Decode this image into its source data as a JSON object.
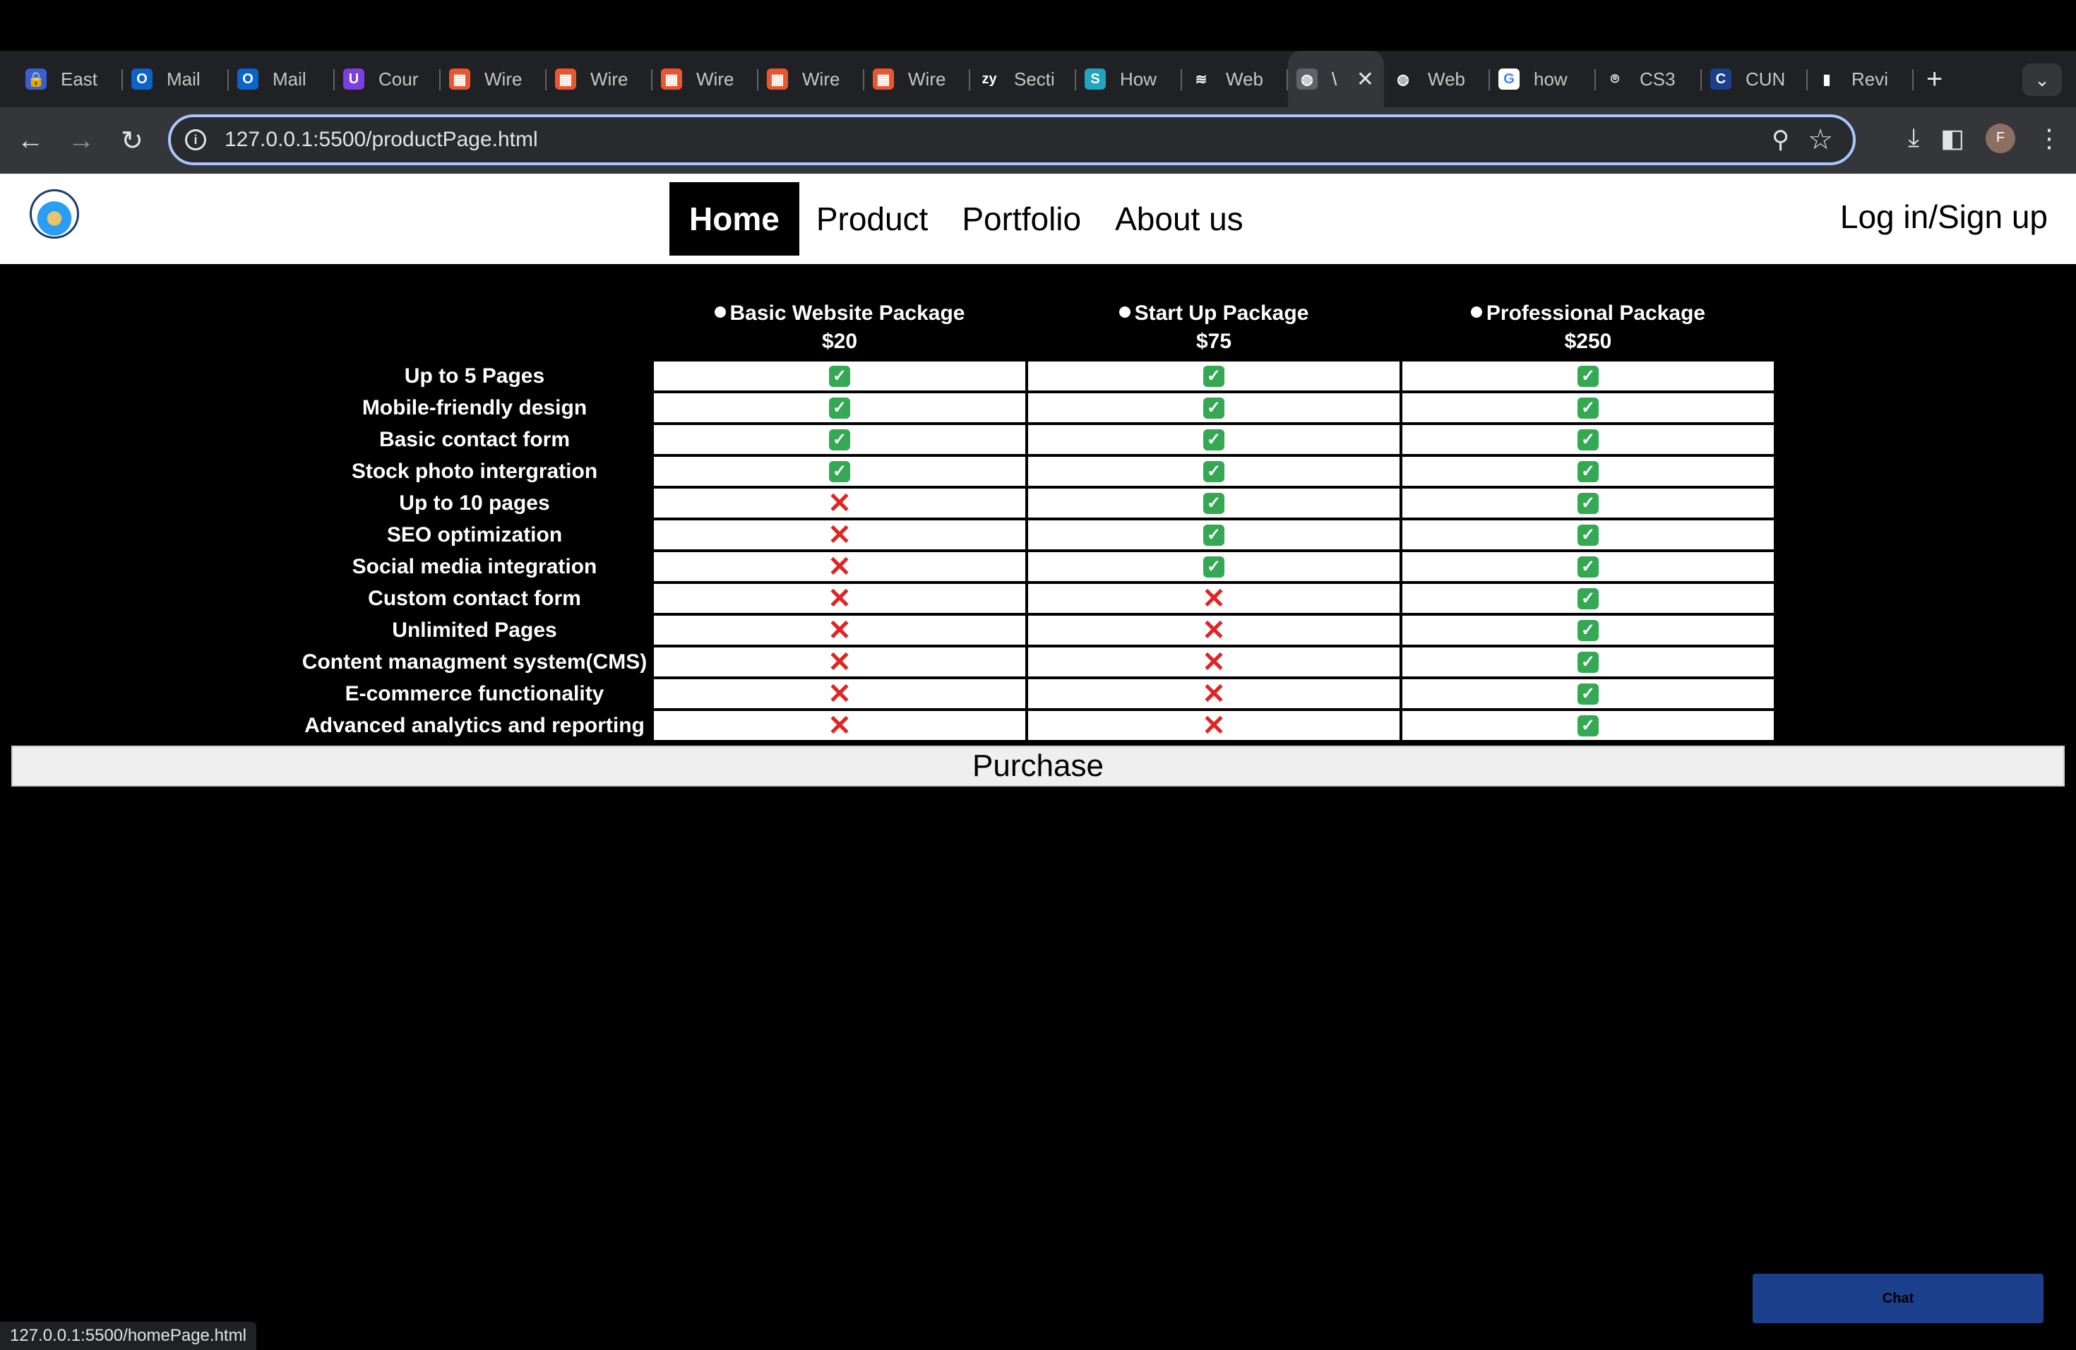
{
  "browser": {
    "tabs": [
      {
        "title": "East",
        "color": "#3b5fd1",
        "glyph": "🔒"
      },
      {
        "title": "Mail",
        "color": "#0a64c9",
        "glyph": "O"
      },
      {
        "title": "Mail",
        "color": "#0a64c9",
        "glyph": "O"
      },
      {
        "title": "Cour",
        "color": "#7b3fe4",
        "glyph": "U"
      },
      {
        "title": "Wire",
        "color": "#e8572f",
        "glyph": "▦"
      },
      {
        "title": "Wire",
        "color": "#e8572f",
        "glyph": "▦"
      },
      {
        "title": "Wire",
        "color": "#e8572f",
        "glyph": "▦"
      },
      {
        "title": "Wire",
        "color": "#e8572f",
        "glyph": "▦"
      },
      {
        "title": "Wire",
        "color": "#e8572f",
        "glyph": "▦"
      },
      {
        "title": "Secti",
        "color": "#202124",
        "glyph": "zy"
      },
      {
        "title": "How",
        "color": "#21a3c1",
        "glyph": "S"
      },
      {
        "title": "Web",
        "color": "#202124",
        "glyph": "≋"
      }
    ],
    "active_tab": {
      "title": "\\",
      "glyph": "◍"
    },
    "tabs_after": [
      {
        "title": "Web",
        "color": "#202124",
        "glyph": "◍"
      },
      {
        "title": "how",
        "color": "#ffffff",
        "glyph": "G"
      },
      {
        "title": "CS3",
        "color": "#202124",
        "glyph": "⌾"
      },
      {
        "title": "CUN",
        "color": "#1c3f8c",
        "glyph": "C"
      },
      {
        "title": "Revi",
        "color": "#202124",
        "glyph": "▮"
      }
    ],
    "url": "127.0.0.1:5500/productPage.html",
    "avatar_letter": "F",
    "status_url": "127.0.0.1:5500/homePage.html"
  },
  "site": {
    "nav": [
      "Home",
      "Product",
      "Portfolio",
      "About us"
    ],
    "login": "Log in/Sign up",
    "packages": [
      {
        "name": "Basic Website Package",
        "price": "$20"
      },
      {
        "name": "Start Up Package",
        "price": "$75"
      },
      {
        "name": "Professional Package",
        "price": "$250"
      }
    ],
    "features": [
      {
        "label": "Up to 5 Pages",
        "values": [
          true,
          true,
          true
        ]
      },
      {
        "label": "Mobile-friendly design",
        "values": [
          true,
          true,
          true
        ]
      },
      {
        "label": "Basic contact form",
        "values": [
          true,
          true,
          true
        ]
      },
      {
        "label": "Stock photo intergration",
        "values": [
          true,
          true,
          true
        ]
      },
      {
        "label": "Up to 10 pages",
        "values": [
          false,
          true,
          true
        ]
      },
      {
        "label": "SEO optimization",
        "values": [
          false,
          true,
          true
        ]
      },
      {
        "label": "Social media integration",
        "values": [
          false,
          true,
          true
        ]
      },
      {
        "label": "Custom contact form",
        "values": [
          false,
          false,
          true
        ]
      },
      {
        "label": "Unlimited Pages",
        "values": [
          false,
          false,
          true
        ]
      },
      {
        "label": "Content managment system(CMS)",
        "values": [
          false,
          false,
          true
        ]
      },
      {
        "label": "E-commerce functionality",
        "values": [
          false,
          false,
          true
        ]
      },
      {
        "label": "Advanced analytics and reporting",
        "values": [
          false,
          false,
          true
        ]
      }
    ],
    "purchase": "Purchase",
    "chat": "Chat"
  }
}
